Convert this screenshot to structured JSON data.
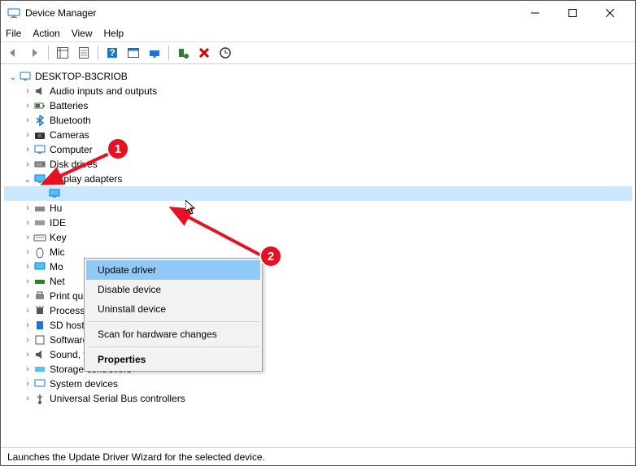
{
  "window": {
    "title": "Device Manager"
  },
  "menubar": [
    "File",
    "Action",
    "View",
    "Help"
  ],
  "tree": {
    "root": "DESKTOP-B3CRIOB",
    "categories": [
      {
        "label": "Audio inputs and outputs"
      },
      {
        "label": "Batteries"
      },
      {
        "label": "Bluetooth"
      },
      {
        "label": "Cameras"
      },
      {
        "label": "Computer"
      },
      {
        "label": "Disk drives"
      },
      {
        "label": "Display adapters",
        "expanded": true,
        "children": [
          {
            "label": ""
          }
        ]
      },
      {
        "label": "Hu"
      },
      {
        "label": "IDE"
      },
      {
        "label": "Key"
      },
      {
        "label": "Mic"
      },
      {
        "label": "Mo"
      },
      {
        "label": "Net"
      },
      {
        "label": "Print queues"
      },
      {
        "label": "Processors"
      },
      {
        "label": "SD host adapters"
      },
      {
        "label": "Software devices"
      },
      {
        "label": "Sound, video and game controllers"
      },
      {
        "label": "Storage controllers"
      },
      {
        "label": "System devices"
      },
      {
        "label": "Universal Serial Bus controllers"
      }
    ]
  },
  "context_menu": {
    "items": [
      {
        "label": "Update driver",
        "highlighted": true
      },
      {
        "label": "Disable device"
      },
      {
        "label": "Uninstall device"
      },
      {
        "sep": true
      },
      {
        "label": "Scan for hardware changes"
      },
      {
        "sep": true
      },
      {
        "label": "Properties",
        "bold": true
      }
    ]
  },
  "statusbar": {
    "text": "Launches the Update Driver Wizard for the selected device."
  },
  "annotations": {
    "1": "1",
    "2": "2"
  }
}
